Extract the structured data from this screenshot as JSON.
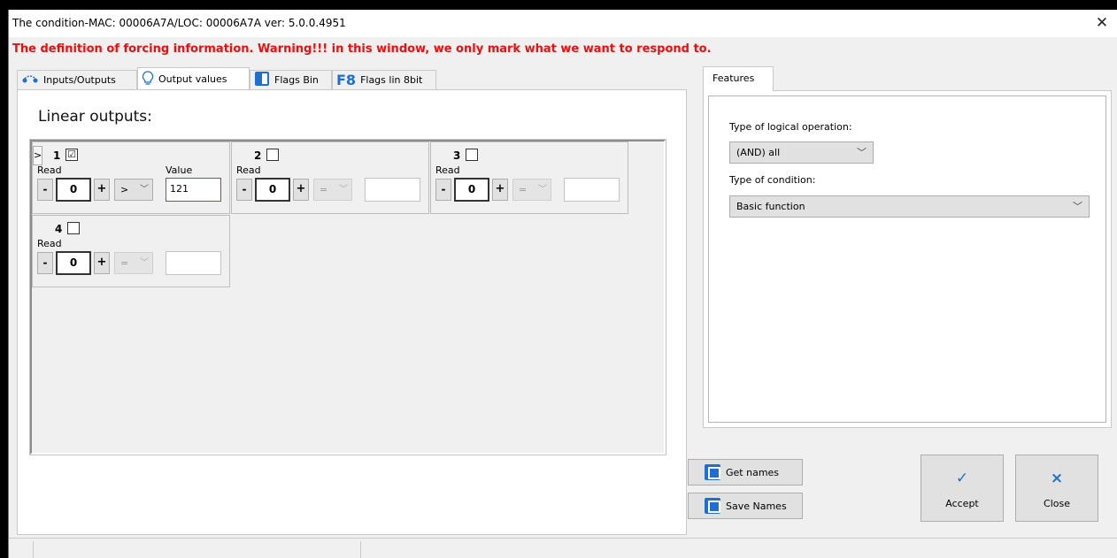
{
  "window": {
    "title": "The condition-MAC: 00006A7A/LOC: 00006A7A ver: 5.0.0.4951",
    "close_glyph": "✕"
  },
  "warning": "The definition of forcing information. Warning!!! in this window, we only mark what we want to respond to.",
  "tabs": [
    {
      "label": "Inputs/Outputs",
      "icon": "io-icon"
    },
    {
      "label": "Output values",
      "icon": "lightbulb-icon"
    },
    {
      "label": "Flags Bin",
      "icon": "flag-bin-icon"
    },
    {
      "label": "Flags lin 8bit",
      "icon": "f8-icon",
      "icon_text": "F8"
    }
  ],
  "linear_outputs": {
    "title": "Linear outputs:",
    "expand_glyph": ">",
    "cells": [
      {
        "num": "1",
        "checked": "☑",
        "read_label": "Read",
        "value_label": "Value",
        "minus": "-",
        "counter": "0",
        "plus": "+",
        "op": ">",
        "value": "121"
      },
      {
        "num": "2",
        "checked": "",
        "read_label": "Read",
        "value_label": "",
        "minus": "-",
        "counter": "0",
        "plus": "+",
        "op": "=",
        "value": ""
      },
      {
        "num": "3",
        "checked": "",
        "read_label": "Read",
        "value_label": "",
        "minus": "-",
        "counter": "0",
        "plus": "+",
        "op": "=",
        "value": ""
      },
      {
        "num": "4",
        "checked": "",
        "read_label": "Read",
        "value_label": "",
        "minus": "-",
        "counter": "0",
        "plus": "+",
        "op": "=",
        "value": ""
      }
    ]
  },
  "features": {
    "tab_label": "Features",
    "logical_op_label": "Type of logical operation:",
    "logical_op_value": "(AND) all",
    "condition_label": "Type of condition:",
    "condition_value": "Basic function"
  },
  "buttons": {
    "get_names": "Get names",
    "save_names": "Save Names",
    "accept": "Accept",
    "accept_glyph": "✓",
    "close": "Close",
    "close_glyph": "×"
  },
  "colors": {
    "warning": "#e81010",
    "accent": "#1f6fd0"
  }
}
